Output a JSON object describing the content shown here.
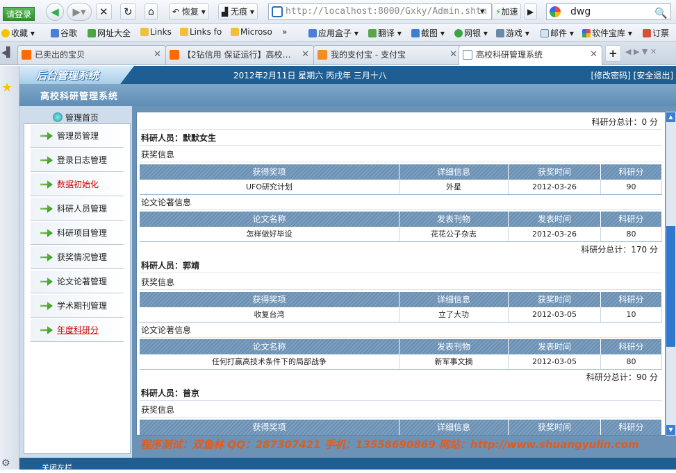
{
  "browser": {
    "login": "请登录",
    "restore": "恢复",
    "incognito": "无痕",
    "address": "http://localhost:8000/Gxky/Admin.shtm",
    "speedup": "加速",
    "search_value": "dwg",
    "bookmarks": [
      "收藏",
      "谷歌",
      "网址大全",
      "Links",
      "Links fo",
      "Microso",
      "»",
      "应用盒子",
      "翻译",
      "截图",
      "网银",
      "游戏",
      "邮件",
      "软件宝库",
      "订票"
    ],
    "tabs": [
      {
        "label": "已卖出的宝贝",
        "active": false
      },
      {
        "label": "【2钻信用 保证运行】高校…",
        "active": false
      },
      {
        "label": "我的支付宝 - 支付宝",
        "active": false
      },
      {
        "label": "高校科研管理系统",
        "active": true
      }
    ]
  },
  "app": {
    "logo": "后台管理系统",
    "date": "2012年2月11日 星期六 丙戌年 三月十八",
    "links": "[修改密码] [安全退出]",
    "subtitle": "高校科研管理系统",
    "home": "管理首页",
    "menu": [
      "管理员管理",
      "登录日志管理",
      "数据初始化",
      "科研人员管理",
      "科研项目管理",
      "获奖情况管理",
      "论文论著管理",
      "学术期刊管理",
      "年度科研分"
    ],
    "credit": "程序测试：双鱼林   QQ：287307421   手机：13558690869   网站：http://www.shuangyulin.com",
    "footer": "关闭左栏"
  },
  "content": {
    "top_total": "科研分总计：0 分",
    "award_header": [
      "获得奖项",
      "详细信息",
      "获奖时间",
      "科研分"
    ],
    "paper_header": [
      "论文名称",
      "发表刊物",
      "发表时间",
      "科研分"
    ],
    "award_label": "获奖信息",
    "paper_label": "论文论著信息",
    "researchers": [
      {
        "name": "科研人员：默默女生",
        "award": [
          "UFO研究计划",
          "外星",
          "2012-03-26",
          "90"
        ],
        "paper": [
          "怎样做好毕设",
          "花花公子杂志",
          "2012-03-26",
          "80"
        ],
        "total": "科研分总计：170 分"
      },
      {
        "name": "科研人员：郭靖",
        "award": [
          "收复台湾",
          "立了大功",
          "2012-03-05",
          "10"
        ],
        "paper": [
          "任何打赢高技术条件下的局部战争",
          "新军事文摘",
          "2012-03-05",
          "80"
        ],
        "total": "科研分总计：90 分"
      },
      {
        "name": "科研人员：普京"
      }
    ]
  },
  "colors": {
    "header": "#1f5e93",
    "th": "#6b90b3",
    "credit": "#e35b1a",
    "accent": "#2f78d0"
  }
}
